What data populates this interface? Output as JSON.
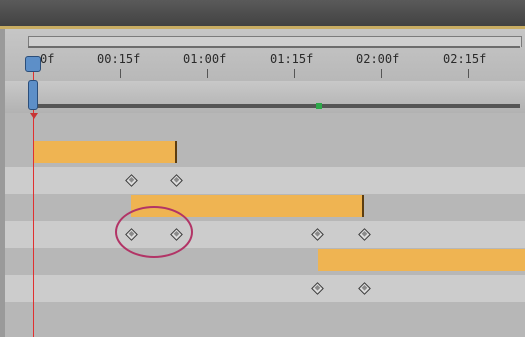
{
  "timeline": {
    "ruler_labels": [
      "0f",
      "00:15f",
      "01:00f",
      "01:15f",
      "02:00f",
      "02:15f"
    ],
    "colors": {
      "layer_bar": "#efb452",
      "current_time_indicator": "#e03030",
      "highlight_ellipse": "#b23466",
      "cache_marker": "#2ea84a",
      "playhead": "#5d8fc8"
    },
    "icons": {
      "keyframe": "keyframe-diamond-icon",
      "playhead": "current-time-indicator-icon"
    }
  }
}
